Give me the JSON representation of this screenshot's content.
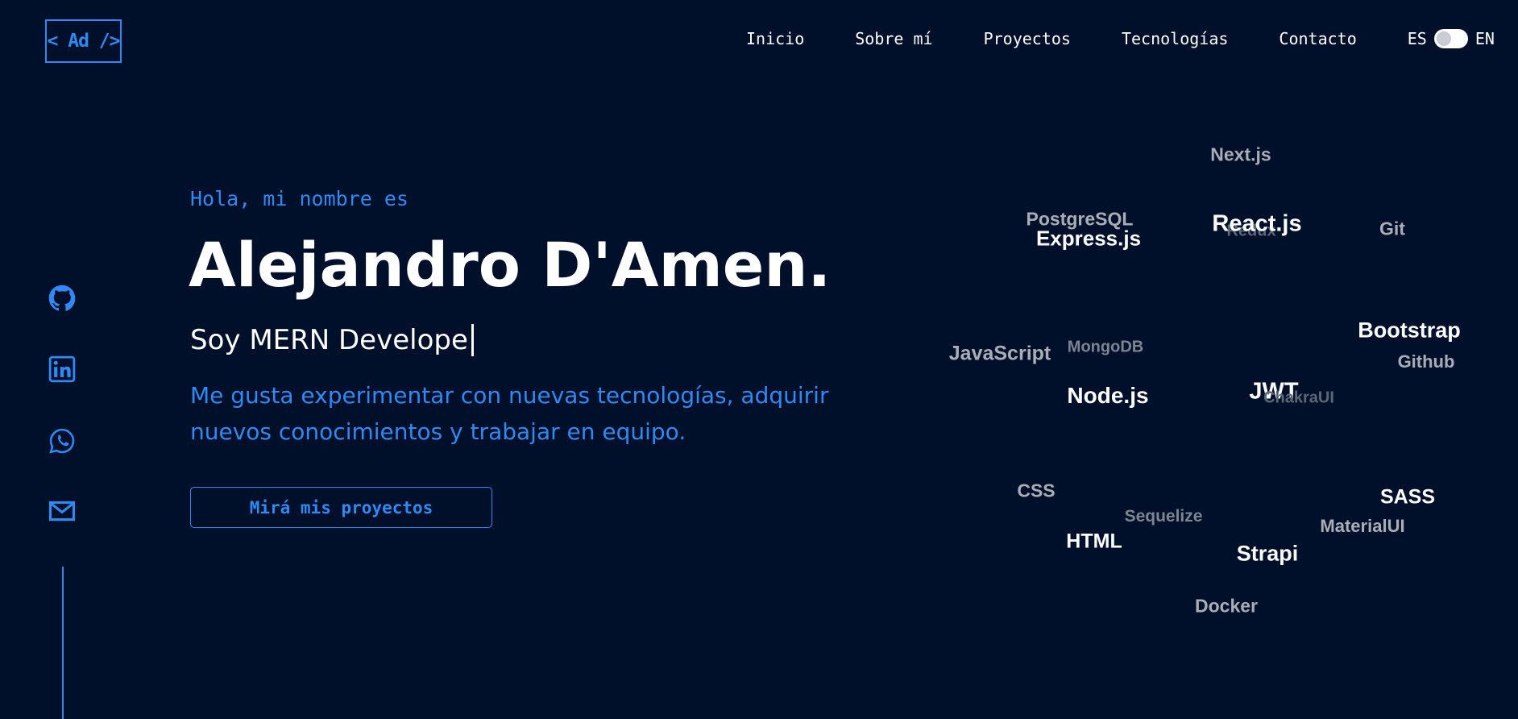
{
  "header": {
    "logo": "< Ad />",
    "nav": [
      "Inicio",
      "Sobre mí",
      "Proyectos",
      "Tecnologías",
      "Contacto"
    ],
    "lang_left": "ES",
    "lang_right": "EN"
  },
  "social": [
    "github-icon",
    "linkedin-icon",
    "whatsapp-icon",
    "mail-icon"
  ],
  "hero": {
    "greeting": "Hola, mi nombre es",
    "name": "Alejandro D'Amen.",
    "role": "Soy MERN Develope",
    "description": "Me gusta experimentar con nuevas tecnologías, adquirir nuevos conocimientos y trabajar en equipo.",
    "cta": "Mirá mis proyectos"
  },
  "tech_cloud": [
    "Next.js",
    "PostgreSQL",
    "Express.js",
    "Redux",
    "React.js",
    "Git",
    "Bootstrap",
    "JavaScript",
    "MongoDB",
    "Github",
    "Node.js",
    "JWT",
    "ChakraUI",
    "CSS",
    "SASS",
    "Sequelize",
    "MaterialUI",
    "HTML",
    "Strapi",
    "Docker"
  ],
  "colors": {
    "background": "#00102a",
    "accent": "#2f8af5",
    "text": "#ffffff",
    "muted": "#a9adb5"
  }
}
